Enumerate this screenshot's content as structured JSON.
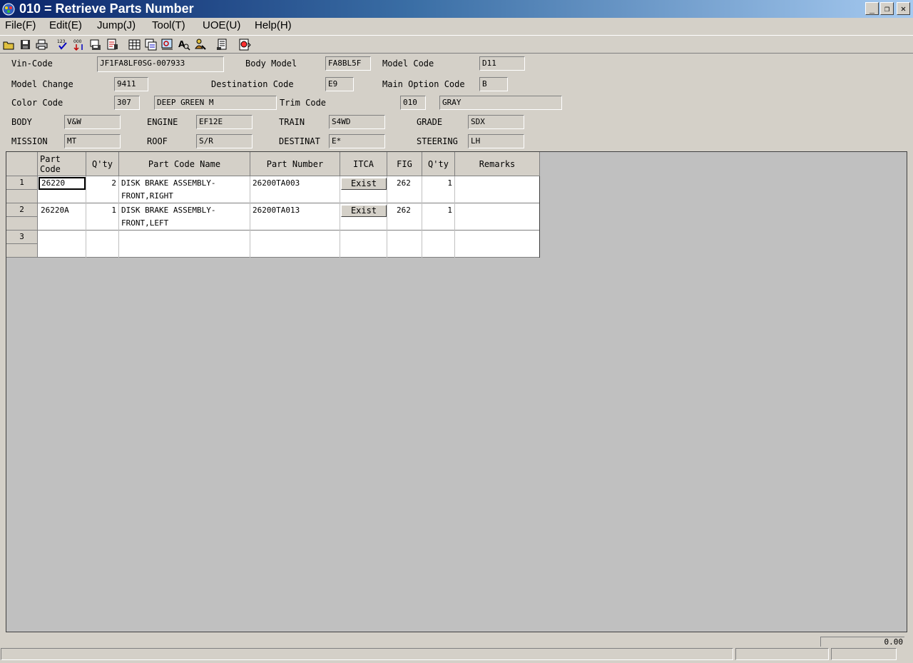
{
  "window": {
    "title": "010 = Retrieve Parts Number"
  },
  "menu": [
    "File(F)",
    "Edit(E)",
    "Jump(J)",
    "Tool(T)",
    "UOE(U)",
    "Help(H)"
  ],
  "header": {
    "vin_label": "Vin-Code",
    "vin_value": "JF1FA8LF0SG-007933",
    "body_model_label": "Body Model",
    "body_model_value": "FA8BL5F",
    "model_code_label": "Model Code",
    "model_code_value": "D11",
    "model_change_label": "Model Change",
    "model_change_value": "9411",
    "destination_label": "Destination Code",
    "destination_value": "E9",
    "main_option_label": "Main Option Code",
    "main_option_value": "B",
    "color_code_label": "Color Code",
    "color_code_value": "307",
    "color_name_value": "DEEP GREEN M",
    "trim_code_label": "Trim Code",
    "trim_code_value": "010",
    "trim_name_value": "GRAY",
    "body_label": "BODY",
    "body_value": "V&W",
    "engine_label": "ENGINE",
    "engine_value": "EF12E",
    "train_label": "TRAIN",
    "train_value": "S4WD",
    "grade_label": "GRADE",
    "grade_value": "SDX",
    "mission_label": "MISSION",
    "mission_value": "MT",
    "roof_label": "ROOF",
    "roof_value": "S/R",
    "destinat_label": "DESTINAT",
    "destinat_value": "E*",
    "steering_label": "STEERING",
    "steering_value": "LH"
  },
  "grid": {
    "columns": [
      "Part\nCode",
      "Q'ty",
      "Part Code Name",
      "Part Number",
      "ITCA",
      "FIG",
      "Q'ty",
      "Remarks"
    ],
    "rows": [
      {
        "num": "1",
        "part_code": "26220",
        "qty": "2",
        "name1": "DISK BRAKE ASSEMBLY-",
        "name2": "FRONT,RIGHT",
        "part_number": "26200TA003",
        "itca": "Exist",
        "fig": "262",
        "qty2": "1",
        "remarks": ""
      },
      {
        "num": "2",
        "part_code": "26220A",
        "qty": "1",
        "name1": "DISK BRAKE ASSEMBLY-",
        "name2": "FRONT,LEFT",
        "part_number": "26200TA013",
        "itca": "Exist",
        "fig": "262",
        "qty2": "1",
        "remarks": ""
      },
      {
        "num": "3",
        "part_code": "",
        "qty": "",
        "name1": "",
        "name2": "",
        "part_number": "",
        "itca": "",
        "fig": "",
        "qty2": "",
        "remarks": ""
      }
    ]
  },
  "status": {
    "counter": "0.00"
  }
}
